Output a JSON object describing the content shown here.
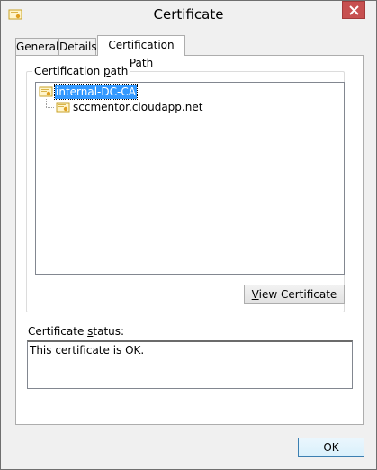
{
  "window": {
    "title": "Certificate",
    "icon": "certificate-icon"
  },
  "tabs": [
    {
      "label": "General",
      "active": false
    },
    {
      "label": "Details",
      "active": false
    },
    {
      "label": "Certification Path",
      "active": true
    }
  ],
  "certification_path": {
    "group_label_pre": "Certification ",
    "group_label_key": "p",
    "group_label_post": "ath",
    "nodes": [
      {
        "label": "internal-DC-CA",
        "selected": true,
        "icon": "certificate-icon"
      },
      {
        "label": "sccmentor.cloudapp.net",
        "selected": false,
        "icon": "certificate-icon"
      }
    ],
    "view_button_key": "V",
    "view_button_rest": "iew Certificate"
  },
  "status": {
    "label_pre": "Certificate ",
    "label_key": "s",
    "label_post": "tatus:",
    "text": "This certificate is OK."
  },
  "footer": {
    "ok_label": "OK"
  }
}
